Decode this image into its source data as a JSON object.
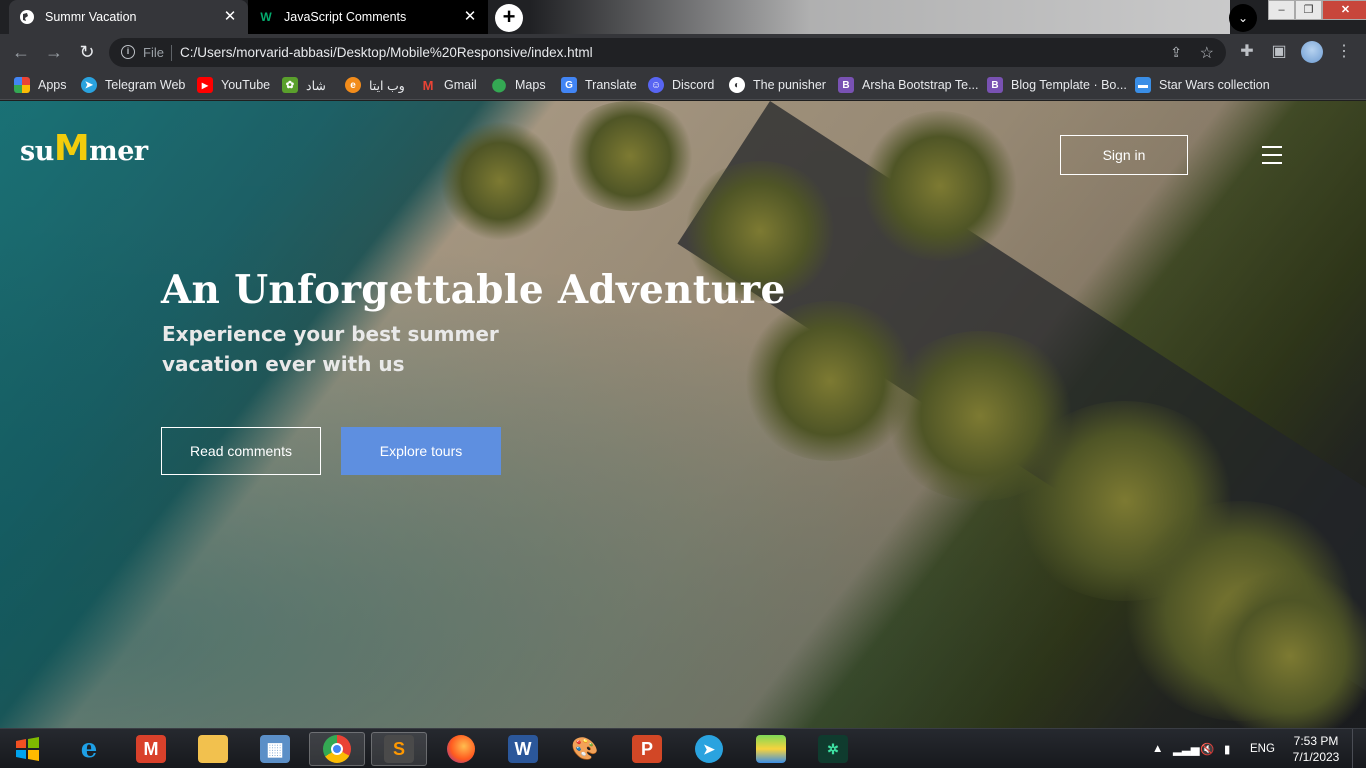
{
  "browser": {
    "tabs": [
      {
        "title": "Summr Vacation",
        "active": true
      },
      {
        "title": "JavaScript Comments",
        "active": false
      }
    ],
    "address": {
      "scheme_label": "File",
      "url": "C:/Users/morvarid-abbasi/Desktop/Mobile%20Responsive/index.html"
    },
    "bookmarks": [
      {
        "label": "Apps",
        "icon": "apps-grid-icon",
        "color": "#e94235"
      },
      {
        "label": "Telegram Web",
        "icon": "telegram-icon",
        "color": "#2aa3df"
      },
      {
        "label": "YouTube",
        "icon": "youtube-icon",
        "color": "#ff0000"
      },
      {
        "label": "شاد",
        "icon": "shad-icon",
        "color": "#5aa02c"
      },
      {
        "label": "وب ایتا",
        "icon": "eitaa-icon",
        "color": "#f28c1b"
      },
      {
        "label": "Gmail",
        "icon": "gmail-icon",
        "color": "#ea4335"
      },
      {
        "label": "Maps",
        "icon": "maps-icon",
        "color": "#34a853"
      },
      {
        "label": "Translate",
        "icon": "translate-icon",
        "color": "#4285f4"
      },
      {
        "label": "Discord",
        "icon": "discord-icon",
        "color": "#5865f2"
      },
      {
        "label": "The punisher",
        "icon": "globe-icon",
        "color": "#ffffff"
      },
      {
        "label": "Arsha Bootstrap Te...",
        "icon": "bootstrap-icon",
        "color": "#7952b3"
      },
      {
        "label": "Blog Template · Bo...",
        "icon": "bootstrap-icon",
        "color": "#7952b3"
      },
      {
        "label": "Star Wars collection",
        "icon": "tv-icon",
        "color": "#3a8ee6"
      }
    ]
  },
  "site": {
    "logo": {
      "part1": "su",
      "big": "M",
      "part2": "mer",
      "accent": "#f2cc0c"
    },
    "signin_label": "Sign in",
    "hero": {
      "title": "An Unforgettable Adventure",
      "subtitle": "Experience your best summer vacation ever with us",
      "read_comments": "Read comments",
      "explore_tours": "Explore tours",
      "button_color": "#5e8fe0"
    }
  },
  "taskbar": {
    "apps": [
      "internet-explorer-icon",
      "m-app-icon",
      "file-explorer-icon",
      "control-panel-icon",
      "chrome-icon",
      "sublime-text-icon",
      "firefox-icon",
      "word-icon",
      "paint-icon",
      "powerpoint-icon",
      "telegram-icon",
      "bluestacks-icon",
      "sound-app-icon"
    ],
    "language": "ENG",
    "time": "7:53 PM",
    "date": "7/1/2023"
  }
}
